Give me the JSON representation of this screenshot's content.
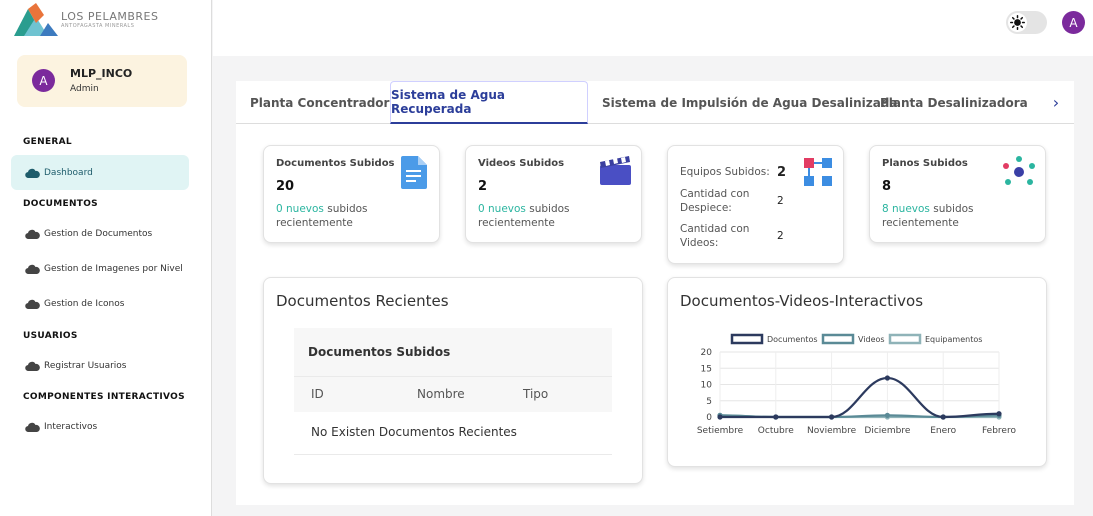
{
  "logo": {
    "title": "LOS PELAMBRES",
    "subtitle": "ANTOFAGASTA MINERALS"
  },
  "user": {
    "initial": "A",
    "name": "MLP_INCO",
    "role": "Admin"
  },
  "sidebar": {
    "sections": {
      "general": "GENERAL",
      "documentos": "DOCUMENTOS",
      "usuarios": "USUARIOS",
      "componentes": "COMPONENTES INTERACTIVOS"
    },
    "items": {
      "dashboard": "Dashboard",
      "gestion_documentos": "Gestion de Documentos",
      "gestion_imagenes": "Gestion de Imagenes por Nivel",
      "gestion_iconos": "Gestion de Iconos",
      "registrar_usuarios": "Registrar Usuarios",
      "interactivos": "Interactivos"
    }
  },
  "topbar": {
    "avatar_initial": "A"
  },
  "tabs": [
    "Planta Concentradora",
    "Sistema de Agua Recuperada",
    "Sistema de Impulsión de Agua Desalinizada",
    "Planta Desalinizadora"
  ],
  "tabs_next": "›",
  "cards": {
    "documentos": {
      "title": "Documentos Subidos",
      "value": "20",
      "new_count": "0 nuevos",
      "suffix": " subidos recientemente"
    },
    "videos": {
      "title": "Videos Subidos",
      "value": "2",
      "new_count": "0 nuevos",
      "suffix": " subidos recientemente"
    },
    "equipos": {
      "title": "Equipos Subidos:",
      "value": "2",
      "despiece_label": "Cantidad con Despiece:",
      "despiece_value": "2",
      "videos_label": "Cantidad con Videos:",
      "videos_value": "2"
    },
    "planos": {
      "title": "Planos Subidos",
      "value": "8",
      "new_count": "8 nuevos",
      "suffix": " subidos recientemente"
    }
  },
  "recent_docs": {
    "title": "Documentos Recientes",
    "table_title": "Documentos Subidos",
    "columns": [
      "ID",
      "Nombre",
      "Tipo"
    ],
    "empty_text": "No Existen Documentos Recientes"
  },
  "chart_data": {
    "type": "line",
    "title": "Documentos-Videos-Interactivos",
    "x": [
      "Setiembre",
      "Octubre",
      "Noviembre",
      "Diciembre",
      "Enero",
      "Febrero"
    ],
    "series": [
      {
        "name": "Documentos",
        "values": [
          0,
          0,
          0,
          12,
          0,
          1
        ],
        "color": "#2c3a5e"
      },
      {
        "name": "Videos",
        "values": [
          0.5,
          0,
          0,
          0.5,
          0,
          0.5
        ],
        "color": "#5a8a96"
      },
      {
        "name": "Equipamentos",
        "values": [
          0.5,
          0,
          0,
          0,
          0,
          0
        ],
        "color": "#8fb3b8"
      }
    ],
    "ylim": [
      0,
      20
    ],
    "yticks": [
      0,
      5,
      10,
      15,
      20
    ],
    "legend": "top",
    "grid": true
  }
}
